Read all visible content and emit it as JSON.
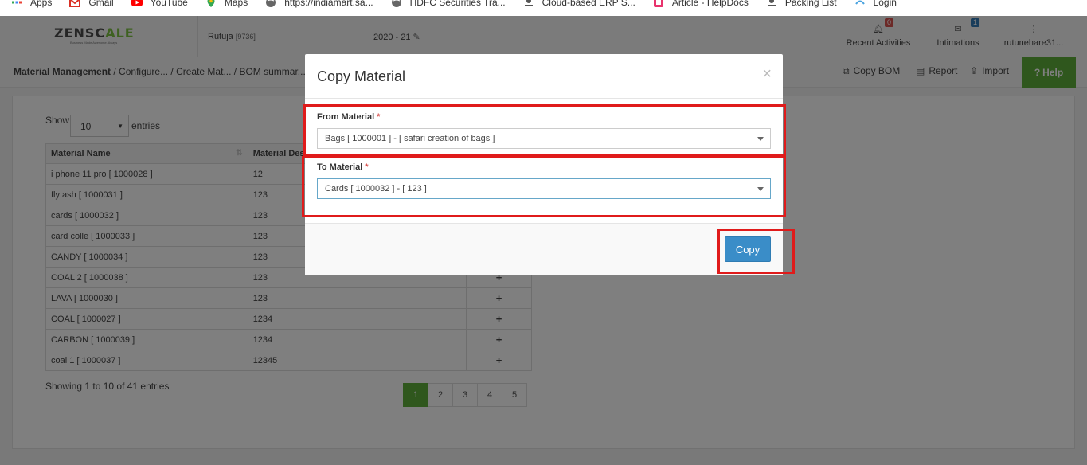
{
  "bookmarks": [
    {
      "label": "Apps",
      "icon": "apps-grid-icon",
      "color": "#4285f4"
    },
    {
      "label": "Gmail",
      "icon": "gmail-icon",
      "color": "#d93025"
    },
    {
      "label": "YouTube",
      "icon": "youtube-icon",
      "color": "#ff0000"
    },
    {
      "label": "Maps",
      "icon": "maps-icon",
      "color": "#34a853"
    },
    {
      "label": "https://indiamart.sa...",
      "icon": "globe-icon",
      "color": "#666666"
    },
    {
      "label": "HDFC Securities Tra...",
      "icon": "globe-icon",
      "color": "#666666"
    },
    {
      "label": "Cloud-based ERP S...",
      "icon": "cloud-icon",
      "color": "#555555"
    },
    {
      "label": "Article - HelpDocs",
      "icon": "helpdocs-icon",
      "color": "#e8336d"
    },
    {
      "label": "Packing List",
      "icon": "packing-icon",
      "color": "#555555"
    },
    {
      "label": "Login",
      "icon": "login-icon",
      "color": "#4aa3df"
    }
  ],
  "header": {
    "logo_main": "ZENSC",
    "logo_accent": "ALE",
    "logo_tagline": "Business Made Awesome Always",
    "user_name": "Rutuja",
    "user_code": "[9736]",
    "fiscal_year": "2020 - 21",
    "recent_activities": {
      "label": "Recent Activities",
      "badge": "0",
      "badge_color": "#d9534f"
    },
    "intimations": {
      "label": "Intimations",
      "badge": "1",
      "badge_color": "#337ab7"
    },
    "account": {
      "label": "rutunehare31..."
    }
  },
  "breadcrumb": {
    "root": "Material Management",
    "rest": " / Configure... / Create Mat... / BOM summar..."
  },
  "actions": {
    "copy_bom": "Copy BOM",
    "report": "Report",
    "import": "Import",
    "help": "Help"
  },
  "table": {
    "show_label": "Show",
    "page_size": "10",
    "entries_label": "entries",
    "columns": [
      "Material Name",
      "Material Des"
    ],
    "rows": [
      {
        "name": "i phone 11 pro [ 1000028 ]",
        "desc": "12"
      },
      {
        "name": "fly ash [ 1000031 ]",
        "desc": "123"
      },
      {
        "name": "cards [ 1000032 ]",
        "desc": "123"
      },
      {
        "name": "card colle [ 1000033 ]",
        "desc": "123"
      },
      {
        "name": "CANDY [ 1000034 ]",
        "desc": "123"
      },
      {
        "name": "COAL 2 [ 1000038 ]",
        "desc": "123"
      },
      {
        "name": "LAVA [ 1000030 ]",
        "desc": "123"
      },
      {
        "name": "COAL [ 1000027 ]",
        "desc": "1234"
      },
      {
        "name": "CARBON [ 1000039 ]",
        "desc": "1234"
      },
      {
        "name": "coal 1 [ 1000037 ]",
        "desc": "12345"
      }
    ],
    "plus_symbol": "+",
    "summary": "Showing 1 to 10 of 41 entries",
    "pages": [
      "1",
      "2",
      "3",
      "4",
      "5"
    ],
    "active_page": "1"
  },
  "modal": {
    "title": "Copy Material",
    "close": "×",
    "from_label": "From Material",
    "from_value": "Bags [ 1000001 ] - [ safari creation of bags ]",
    "to_label": "To Material",
    "to_value": "Cards [ 1000032 ] - [ 123 ]",
    "required_mark": "*",
    "copy_button": "Copy"
  },
  "colors": {
    "brand_green": "#5fae3b",
    "copy_button_blue": "#3a8dc8",
    "highlight_red": "#e01b1b"
  }
}
